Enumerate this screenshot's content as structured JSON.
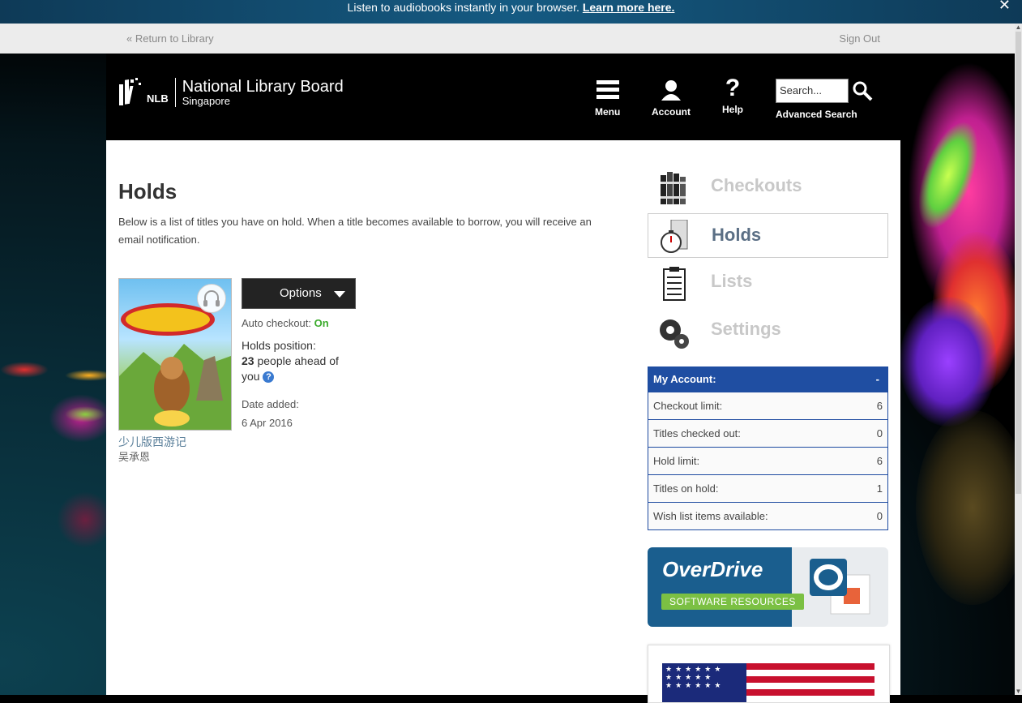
{
  "banner": {
    "text": "Listen to audiobooks instantly in your browser.",
    "link": "Learn more here.",
    "close": "✕"
  },
  "subnav": {
    "return": "« Return to Library",
    "signout": "Sign Out"
  },
  "header": {
    "logo_short": "NLB",
    "logo_name": "National Library Board",
    "logo_sub": "Singapore",
    "menu": "Menu",
    "account": "Account",
    "help": "Help",
    "help_glyph": "?",
    "search_placeholder": "Search...",
    "advanced_search": "Advanced Search"
  },
  "page": {
    "title": "Holds",
    "description": "Below is a list of titles you have on hold. When a title becomes available to borrow, you will receive an email notification."
  },
  "hold": {
    "cover_title": "少儿版西游记",
    "author": "吴承恩",
    "options_label": "Options",
    "auto_checkout_label": "Auto checkout:",
    "auto_checkout_value": "On",
    "holds_position_label": "Holds position:",
    "ahead_count": "23",
    "ahead_text": "people ahead of you",
    "help_glyph": "?",
    "date_added_label": "Date added:",
    "date_added": "6 Apr 2016",
    "icons": [
      "headphones-icon"
    ]
  },
  "sidebar": {
    "nav": [
      {
        "label": "Checkouts",
        "icon": "books-icon"
      },
      {
        "label": "Holds",
        "icon": "stopwatch-icon"
      },
      {
        "label": "Lists",
        "icon": "clipboard-icon"
      },
      {
        "label": "Settings",
        "icon": "gears-icon"
      }
    ],
    "account": {
      "title": "My Account:",
      "toggle": "-",
      "rows": [
        {
          "label": "Checkout limit:",
          "value": "6"
        },
        {
          "label": "Titles checked out:",
          "value": "0"
        },
        {
          "label": "Hold limit:",
          "value": "6"
        },
        {
          "label": "Titles on hold:",
          "value": "1"
        },
        {
          "label": "Wish list items available:",
          "value": "0"
        }
      ]
    },
    "overdrive": {
      "brand": "OverDrive",
      "tagline": "SOFTWARE RESOURCES"
    },
    "flag_stars": "★★★★★★ ★★★★★ ★★★★★★"
  },
  "colors": {
    "header_bg": "#000000",
    "accent_blue": "#1f4ea2",
    "on_green": "#3bab2c",
    "banner": "#155a82"
  }
}
